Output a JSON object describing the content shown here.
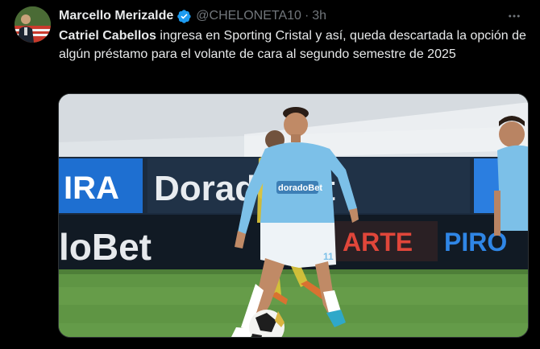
{
  "author": {
    "display_name": "Marcello Merizalde",
    "handle": "@CHELONETA10",
    "separator": "·",
    "time": "3h",
    "verified": true,
    "verified_color": "#1d9bf0"
  },
  "tweet": {
    "bold_text": "Catriel Cabellos",
    "text": " ingresa en Sporting Cristal y así, queda descartada la opción de algún préstamo para el volante de cara al segundo semestre de 2025"
  },
  "more_icon": "more-horizontal-icon",
  "media": {
    "board_texts": [
      "IRA",
      "DoradoBet",
      "loBet",
      "ARTE",
      "PIRO"
    ],
    "shirt_text": "doradoBet",
    "shirt_number": "11",
    "colors": {
      "sky_shirt": "#7cc0e8",
      "pitch": "#5f9544",
      "board_dark": "#1b2b3e",
      "board_blue": "#1e6fd1"
    }
  }
}
